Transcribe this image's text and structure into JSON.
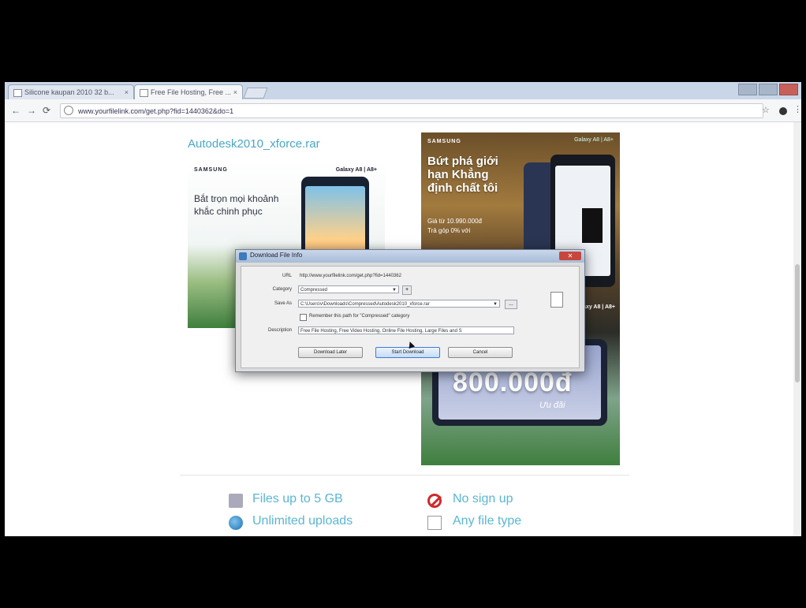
{
  "browser": {
    "tabs": [
      {
        "label": "Silicone kaupan 2010 32 b..."
      },
      {
        "label": "Free File Hosting, Free ..."
      }
    ],
    "url": "www.yourfilelink.com/get.php?fid=1440362&do=1"
  },
  "page": {
    "file_title": "Autodesk2010_xforce.rar",
    "ad_left": {
      "brand": "SAMSUNG",
      "model": "Galaxy A8 | A8+",
      "slogan": "Bắt trọn mọi khoảnh khắc chinh phục"
    },
    "ad_right": {
      "brand": "SAMSUNG",
      "model": "Galaxy A8 | A8+",
      "headline": "Bứt phá giới hạn Khẳng định chất tôi",
      "price": "Giá từ 10.990.000đ",
      "gift": "Trả góp 0% với",
      "model_bottom": "Galaxy A8 | A8+",
      "amount": "800.000đ",
      "amount_note": "Ưu đãi"
    },
    "features": [
      {
        "label": "Files up to 5 GB",
        "icon": "disk-icon"
      },
      {
        "label": "No sign up",
        "icon": "no-sign-up-icon"
      },
      {
        "label": "Unlimited uploads",
        "icon": "globe-icon"
      },
      {
        "label": "Any file type",
        "icon": "file-type-icon"
      }
    ]
  },
  "dialog": {
    "title": "Download File Info",
    "url_label": "URL",
    "url_value": "http://www.yourfilelink.com/get.php?fid=1440362",
    "category_label": "Category",
    "category_value": "Compressed",
    "category_add": "+",
    "saveas_label": "Save As",
    "saveas_value": "C:\\Users\\v\\Downloads\\Compressed\\Autodesk2010_xforce.rar",
    "browse": "...",
    "remember_label": "Remember this path for \"Compressed\" category",
    "description_label": "Description",
    "description_value": "Free File Hosting, Free Video Hosting, Online File Hosting, Large Files and S",
    "btn_later": "Download Later",
    "btn_start": "Start Download",
    "btn_cancel": "Cancel",
    "close": "✕"
  }
}
